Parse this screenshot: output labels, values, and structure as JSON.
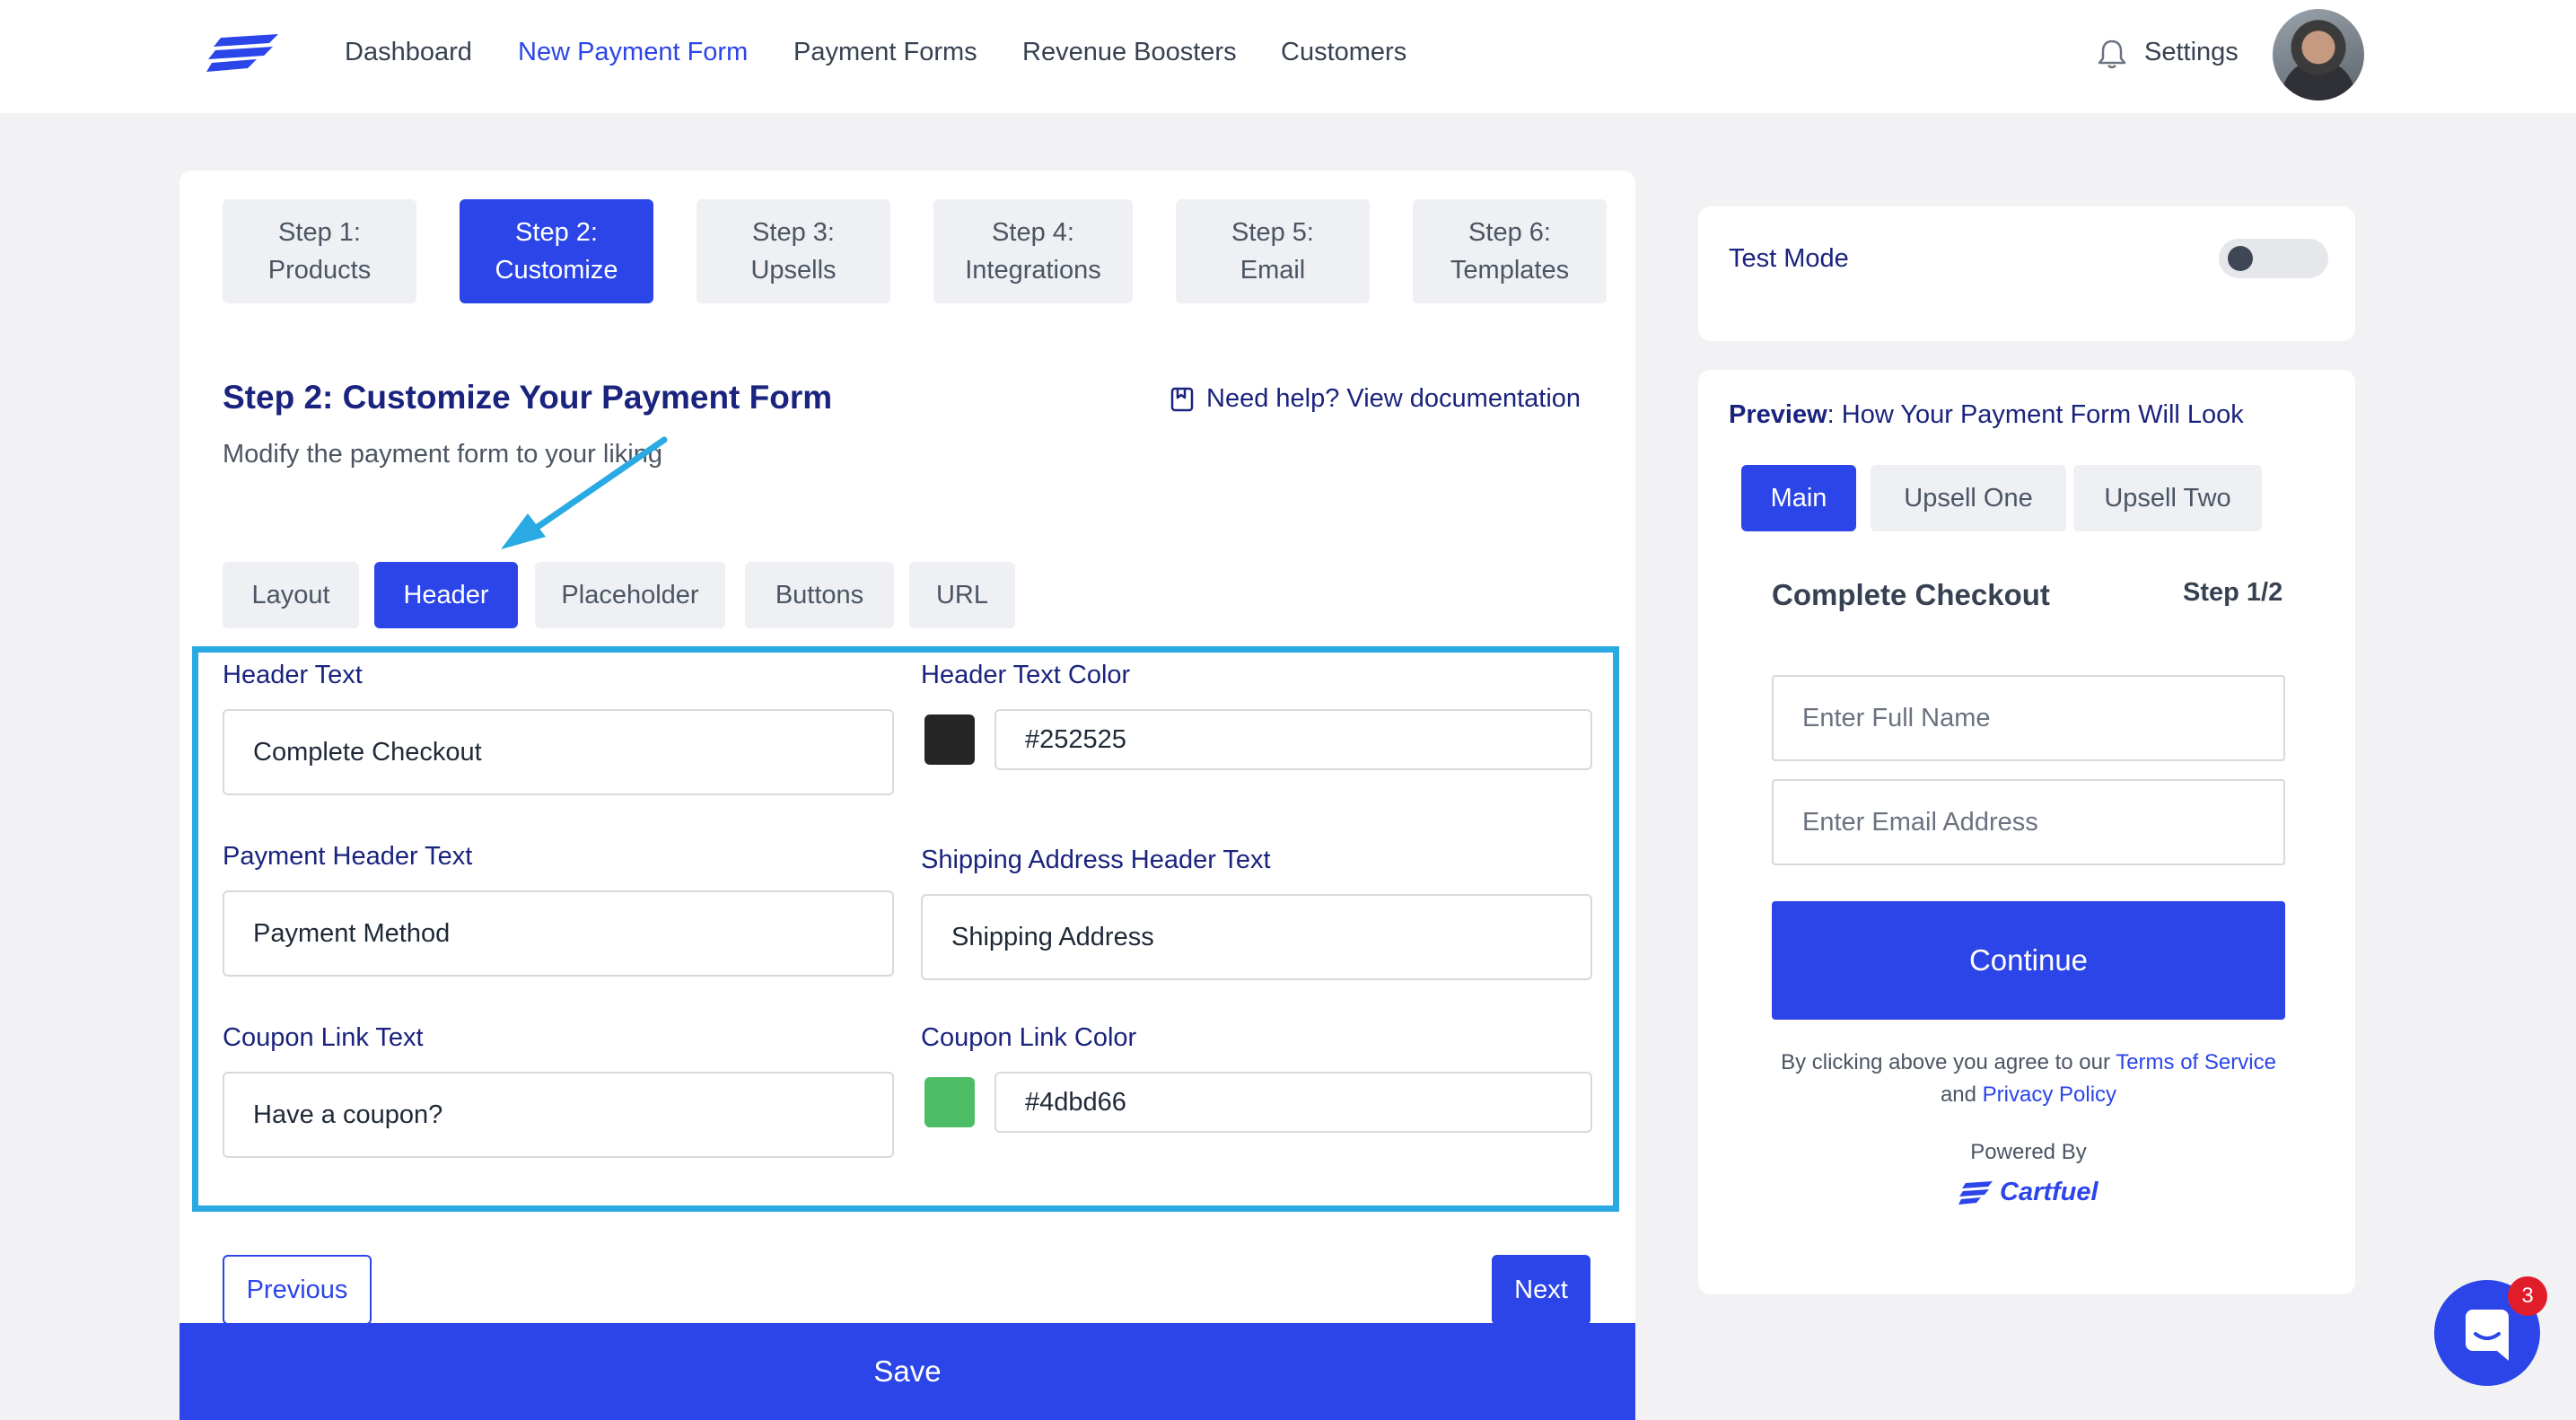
{
  "nav": {
    "items": [
      "Dashboard",
      "New Payment Form",
      "Payment Forms",
      "Revenue Boosters",
      "Customers"
    ],
    "active": "New Payment Form",
    "settings_label": "Settings"
  },
  "steps": [
    {
      "line1": "Step 1:",
      "line2": "Products",
      "active": false
    },
    {
      "line1": "Step 2:",
      "line2": "Customize",
      "active": true
    },
    {
      "line1": "Step 3:",
      "line2": "Upsells",
      "active": false
    },
    {
      "line1": "Step 4:",
      "line2": "Integrations",
      "active": false
    },
    {
      "line1": "Step 5:",
      "line2": "Email",
      "active": false
    },
    {
      "line1": "Step 6:",
      "line2": "Templates",
      "active": false
    }
  ],
  "section": {
    "title": "Step 2: Customize Your Payment Form",
    "subtitle": "Modify the payment form to your liking",
    "help_link": "Need help? View documentation"
  },
  "tabs": [
    "Layout",
    "Header",
    "Placeholder",
    "Buttons",
    "URL"
  ],
  "active_tab": "Header",
  "fields": {
    "header_text": {
      "label": "Header Text",
      "value": "Complete Checkout"
    },
    "header_text_color": {
      "label": "Header Text Color",
      "value": "#252525"
    },
    "payment_header_text": {
      "label": "Payment Header Text",
      "value": "Payment Method"
    },
    "shipping_header_text": {
      "label": "Shipping Address Header Text",
      "value": "Shipping Address"
    },
    "coupon_link_text": {
      "label": "Coupon Link Text",
      "value": "Have a coupon?"
    },
    "coupon_link_color": {
      "label": "Coupon Link Color",
      "value": "#4dbd66"
    }
  },
  "buttons": {
    "previous": "Previous",
    "next": "Next",
    "save": "Save"
  },
  "test_mode": {
    "label": "Test Mode",
    "enabled": false
  },
  "preview": {
    "heading_bold": "Preview",
    "heading_rest": ": How Your Payment Form Will Look",
    "tabs": [
      "Main",
      "Upsell One",
      "Upsell Two"
    ],
    "active_tab": "Main",
    "checkout_title": "Complete Checkout",
    "step": "Step 1/2",
    "name_placeholder": "Enter Full Name",
    "email_placeholder": "Enter Email Address",
    "continue_label": "Continue",
    "terms_prefix": "By clicking above you agree to our ",
    "terms_link": "Terms of Service",
    "terms_and": " and ",
    "privacy_link": "Privacy Policy",
    "powered_by": "Powered By",
    "brand": "Cartfuel"
  },
  "chat": {
    "badge": "3"
  },
  "colors": {
    "accent": "#2b45e8",
    "highlight": "#29aae2",
    "dark_swatch": "#252525",
    "green_swatch": "#4dbd66",
    "badge": "#e11d2a"
  }
}
